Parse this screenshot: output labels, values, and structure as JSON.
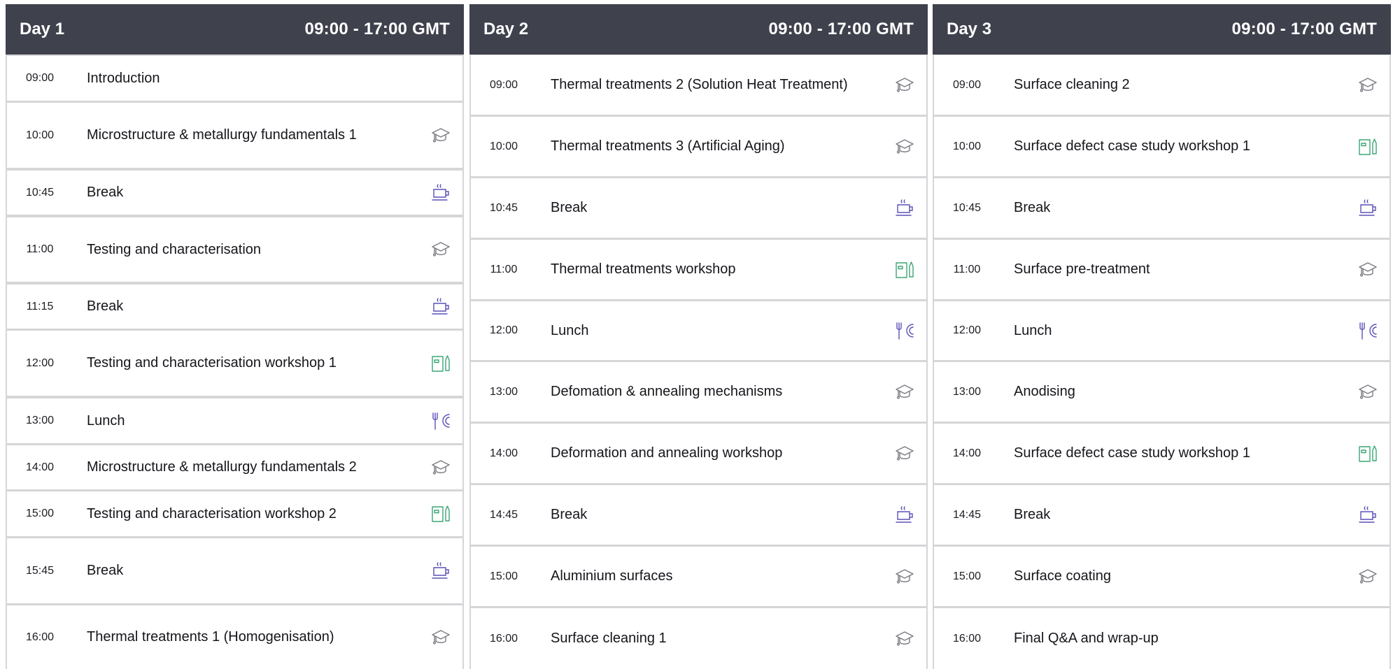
{
  "colors": {
    "header_bg": "#3f414d",
    "cap_icon": "#7a7a82",
    "coffee_icon": "#5a50b8",
    "lunch_icon": "#5a50b8",
    "workshop_icon": "#3aa574"
  },
  "days": [
    {
      "label": "Day 1",
      "hours": "09:00 - 17:00 GMT",
      "sessions": [
        {
          "time": "09:00",
          "title": "Introduction",
          "icon": "none"
        },
        {
          "time": "10:00",
          "title": "Microstructure & metallurgy fundamentals 1",
          "icon": "graduation-cap"
        },
        {
          "time": "10:45",
          "title": "Break",
          "icon": "coffee-cup"
        },
        {
          "time": "11:00",
          "title": "Testing and characterisation",
          "icon": "graduation-cap"
        },
        {
          "time": "11:15",
          "title": "Break",
          "icon": "coffee-cup"
        },
        {
          "time": "12:00",
          "title": "Testing and characterisation workshop 1",
          "icon": "workshop"
        },
        {
          "time": "13:00",
          "title": "Lunch",
          "icon": "cutlery"
        },
        {
          "time": "14:00",
          "title": "Microstructure & metallurgy fundamentals 2",
          "icon": "graduation-cap"
        },
        {
          "time": "15:00",
          "title": "Testing and characterisation workshop 2",
          "icon": "workshop"
        },
        {
          "time": "15:45",
          "title": "Break",
          "icon": "coffee-cup"
        },
        {
          "time": "16:00",
          "title": "Thermal treatments 1 (Homogenisation)",
          "icon": "graduation-cap"
        }
      ]
    },
    {
      "label": "Day 2",
      "hours": "09:00 - 17:00 GMT",
      "sessions": [
        {
          "time": "09:00",
          "title": "Thermal treatments 2 (Solution Heat Treatment)",
          "icon": "graduation-cap"
        },
        {
          "time": "10:00",
          "title": "Thermal treatments 3 (Artificial Aging)",
          "icon": "graduation-cap"
        },
        {
          "time": "10:45",
          "title": "Break",
          "icon": "coffee-cup"
        },
        {
          "time": "11:00",
          "title": "Thermal treatments workshop",
          "icon": "workshop"
        },
        {
          "time": "12:00",
          "title": "Lunch",
          "icon": "cutlery"
        },
        {
          "time": "13:00",
          "title": "Defomation & annealing mechanisms",
          "icon": "graduation-cap"
        },
        {
          "time": "14:00",
          "title": "Deformation and annealing workshop",
          "icon": "graduation-cap"
        },
        {
          "time": "14:45",
          "title": "Break",
          "icon": "coffee-cup"
        },
        {
          "time": "15:00",
          "title": "Aluminium surfaces",
          "icon": "graduation-cap"
        },
        {
          "time": "16:00",
          "title": "Surface cleaning 1",
          "icon": "graduation-cap"
        }
      ]
    },
    {
      "label": "Day 3",
      "hours": "09:00 - 17:00 GMT",
      "sessions": [
        {
          "time": "09:00",
          "title": "Surface cleaning 2",
          "icon": "graduation-cap"
        },
        {
          "time": "10:00",
          "title": "Surface defect case study workshop 1",
          "icon": "workshop"
        },
        {
          "time": "10:45",
          "title": "Break",
          "icon": "coffee-cup"
        },
        {
          "time": "11:00",
          "title": "Surface pre-treatment",
          "icon": "graduation-cap"
        },
        {
          "time": "12:00",
          "title": "Lunch",
          "icon": "cutlery"
        },
        {
          "time": "13:00",
          "title": "Anodising",
          "icon": "graduation-cap"
        },
        {
          "time": "14:00",
          "title": "Surface defect case study workshop 1",
          "icon": "workshop"
        },
        {
          "time": "14:45",
          "title": "Break",
          "icon": "coffee-cup"
        },
        {
          "time": "15:00",
          "title": "Surface coating",
          "icon": "graduation-cap"
        },
        {
          "time": "16:00",
          "title": "Final Q&A and wrap-up",
          "icon": "none"
        }
      ]
    }
  ]
}
